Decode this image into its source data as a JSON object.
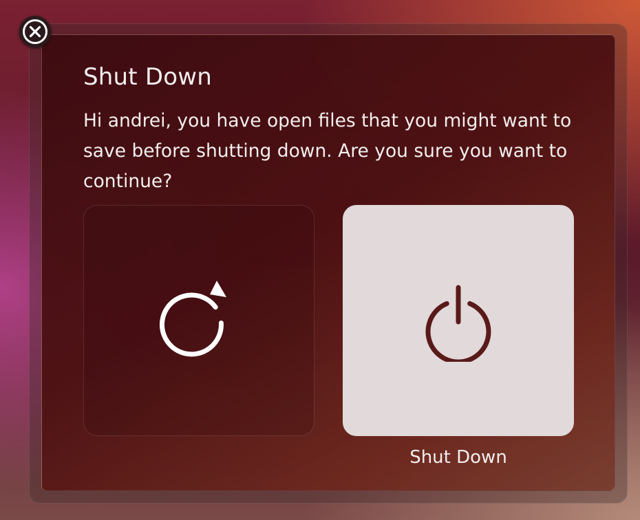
{
  "dialog": {
    "title": "Shut Down",
    "message": "Hi andrei, you have open files that you might want to save before shutting down. Are you sure you want to continue?",
    "actions": [
      {
        "id": "restart",
        "label": "",
        "icon": "restart-icon",
        "selected": false
      },
      {
        "id": "shutdown",
        "label": "Shut Down",
        "icon": "power-icon",
        "selected": true
      }
    ],
    "close_icon": "close-icon"
  },
  "colors": {
    "dialog_background": "#4c1012",
    "selected_tile": "#e1d9da",
    "power_icon": "#5a1a1a",
    "text": "#f3eeee"
  }
}
